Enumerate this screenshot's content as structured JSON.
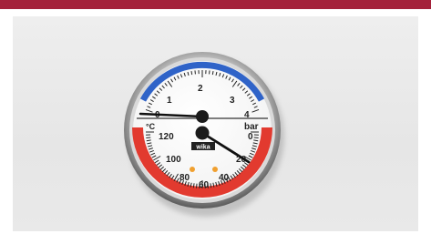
{
  "gauge": {
    "unit_pressure": "bar",
    "unit_temperature": "°C",
    "brand": "wika",
    "pressure_scale": [
      "0",
      "1",
      "2",
      "3",
      "4"
    ],
    "temperature_scale": [
      "0",
      "20",
      "40",
      "60",
      "80",
      "100",
      "120"
    ],
    "pressure_reading_bar": 0,
    "temperature_reading_c": 18,
    "colors": {
      "pressure_band": "#2f63c8",
      "temperature_band": "#e23a2f",
      "accent_bar": "#a4213a"
    }
  }
}
